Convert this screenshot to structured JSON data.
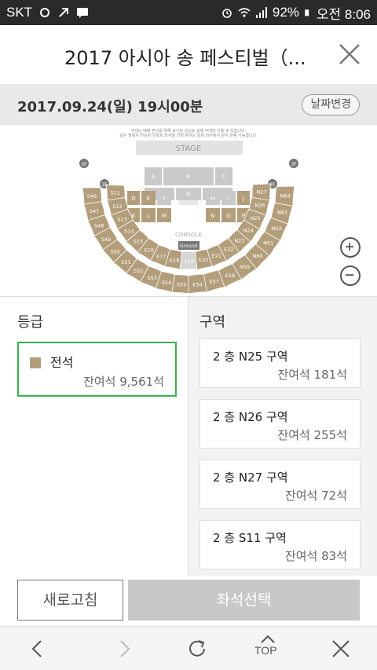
{
  "status_bar": {
    "carrier": "SKT",
    "battery": "92%",
    "time": "오전 8:06"
  },
  "header": {
    "title": "2017 아시아 송 페스티벌（...",
    "close_icon": "close-icon"
  },
  "date_bar": {
    "date": "2017.09.24(일) 19시00분",
    "change_label": "날짜변경"
  },
  "seat_map": {
    "notice_line1": "무대는 예매 편의를 위해 표기된 것으로 실제 무대와 다를 수 있습니다.",
    "notice_line2": "같은 열에서 연속된 번호로 좌석을 선택 하여도 실제 좌석에서 같이 관람 가능합니다.",
    "stage": "STAGE",
    "console": "CONSOLE",
    "ground": "Ground",
    "floor_left_3f": "3F",
    "floor_left_2f": "2F",
    "floor_right_3f": "3F",
    "floor_right_2f": "2F",
    "floor_blocks_top": [
      "A",
      "B",
      "C"
    ],
    "floor_blocks_mid_left": [
      "D",
      "E",
      "F"
    ],
    "floor_blocks_mid_center": "G",
    "floor_blocks_mid_right": [
      "H",
      "I",
      "J"
    ],
    "floor_blocks_low_left": [
      "K",
      "L",
      "M"
    ],
    "floor_blocks_low_right": [
      "N",
      "O",
      "P"
    ],
    "outer_left": [
      "S46",
      "S47",
      "S48",
      "S49",
      "S50",
      "S51",
      "S52",
      "S53",
      "S54",
      "S55"
    ],
    "inner_left": [
      "S11",
      "S12",
      "S13",
      "S14",
      "S15",
      "E16",
      "E17",
      "E18"
    ],
    "center_bottom": "E19",
    "inner_right": [
      "E20",
      "E21",
      "E22",
      "N23",
      "N24",
      "N25",
      "N26",
      "N27"
    ],
    "outer_right": [
      "E56",
      "E57",
      "E58",
      "N59",
      "N60",
      "N61",
      "N62",
      "N63",
      "N64"
    ],
    "zoom_in_icon": "plus-circle-icon",
    "zoom_out_icon": "minus-circle-icon",
    "seat_color": "#b39e7b",
    "disabled_color": "#d6d6d6"
  },
  "grade_panel": {
    "title": "등급",
    "items": [
      {
        "name": "전석",
        "remaining": "잔여석 9,561석",
        "color": "#b39e7b"
      }
    ]
  },
  "zone_panel": {
    "title": "구역",
    "items": [
      {
        "name": "2 층 N25 구역",
        "remaining": "잔여석 181석"
      },
      {
        "name": "2 층 N26 구역",
        "remaining": "잔여석 255석"
      },
      {
        "name": "2 층 N27 구역",
        "remaining": "잔여석 72석"
      },
      {
        "name": "2 층 S11 구역",
        "remaining": "잔여석 83석"
      }
    ]
  },
  "actions": {
    "refresh": "새로고침",
    "select_seat": "좌석선택"
  },
  "browser_nav": {
    "top_label": "TOP"
  }
}
